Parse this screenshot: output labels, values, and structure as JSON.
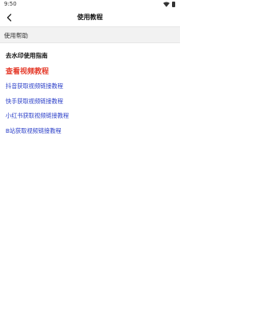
{
  "status_bar": {
    "time": "9:50"
  },
  "header": {
    "title": "使用教程"
  },
  "section": {
    "title": "使用帮助"
  },
  "content": {
    "guide_title": "去水印使用指南",
    "video_tutorial": "查看视频教程",
    "links": [
      "抖音获取视频链接教程",
      "快手获取视频链接教程",
      "小红书获取视频链接教程",
      "B站获取视频链接教程"
    ]
  },
  "colors": {
    "accent_red": "#e53a2a",
    "link_blue": "#2b3fc8"
  }
}
